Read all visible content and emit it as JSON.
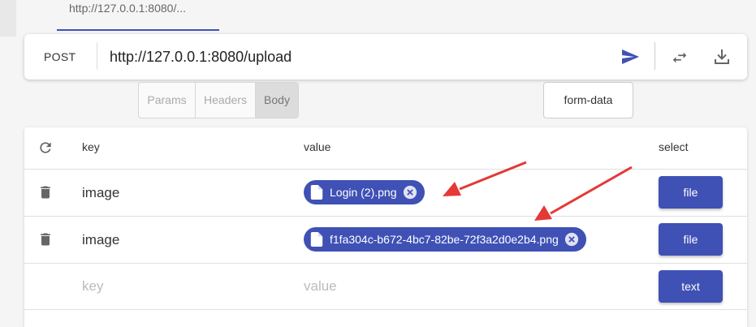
{
  "tab": {
    "label": "http://127.0.0.1:8080/..."
  },
  "request": {
    "method": "POST",
    "url": "http://127.0.0.1:8080/upload"
  },
  "body_tabs": [
    {
      "label": "Params",
      "active": false
    },
    {
      "label": "Headers",
      "active": false
    },
    {
      "label": "Body",
      "active": true
    }
  ],
  "body_type": "form-data",
  "table": {
    "headers": {
      "key": "key",
      "value": "value",
      "select": "select"
    },
    "rows": [
      {
        "key": "image",
        "value": "Login (2).png",
        "select": "file"
      },
      {
        "key": "image",
        "value": "f1fa304c-b672-4bc7-82be-72f3a2d0e2b4.png",
        "select": "file"
      }
    ],
    "new_row": {
      "key_placeholder": "key",
      "value_placeholder": "value",
      "select": "text"
    }
  },
  "colors": {
    "accent": "#3f51b5",
    "annotation_arrow": "#e53935"
  },
  "icons": [
    "send-icon",
    "swap-icon",
    "download-icon",
    "refresh-icon",
    "delete-icon",
    "file-icon",
    "remove-icon"
  ]
}
